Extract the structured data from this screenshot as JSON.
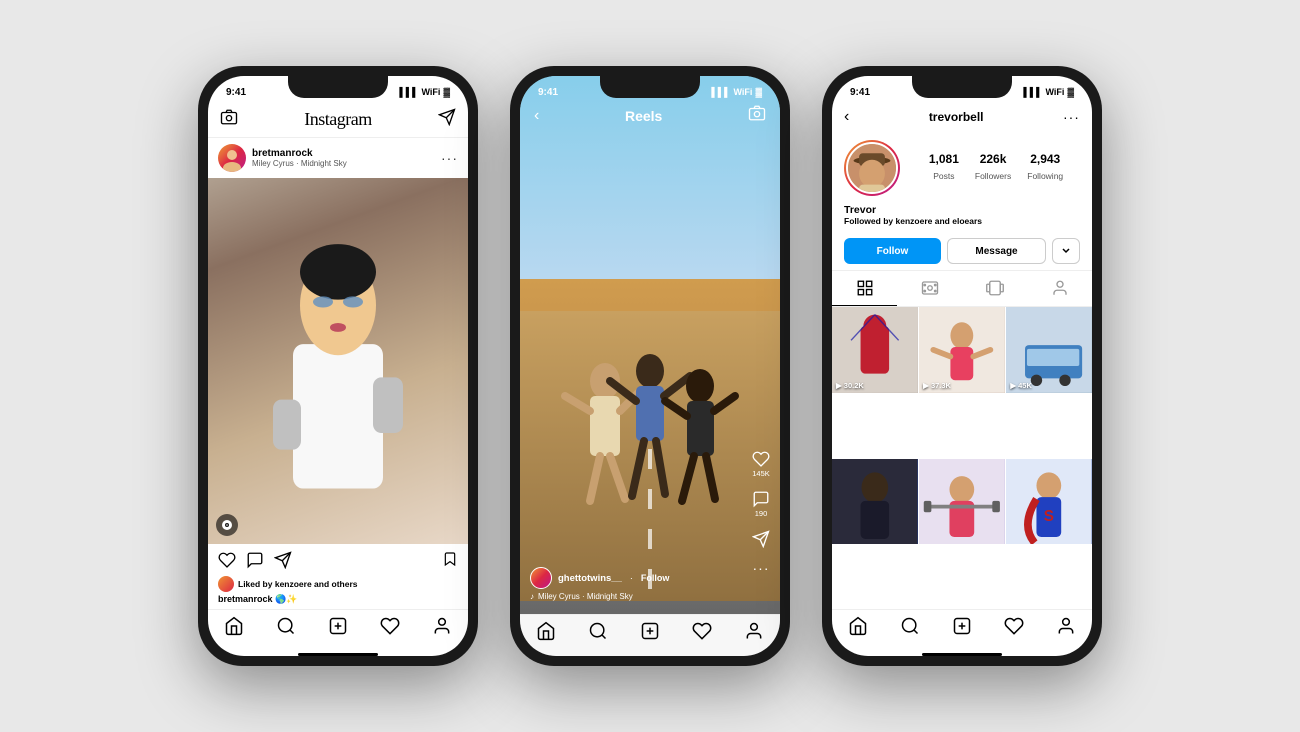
{
  "page": {
    "bg_color": "#e8e8e8"
  },
  "phone1": {
    "status_time": "9:41",
    "header_title": "Instagram",
    "post": {
      "username": "bretmanrock",
      "music": "Miley Cyrus · Midnight Sky",
      "liked_by": "Liked by kenzoere and others",
      "caption_user": "bretmanrock",
      "caption_text": "🌎✨"
    },
    "nav": {
      "home": "⌂",
      "search": "🔍",
      "add": "＋",
      "heart": "♡",
      "profile": "👤"
    }
  },
  "phone2": {
    "status_time": "9:41",
    "title": "Reels",
    "user": {
      "username": "ghettotwins__",
      "follow": "Follow",
      "music": "Miley Cyrus · Midnight Sky"
    },
    "actions": {
      "likes": "145K",
      "comments": "190"
    }
  },
  "phone3": {
    "status_time": "9:41",
    "username": "trevorbell",
    "profile": {
      "name": "Trevor",
      "posts": "1,081",
      "posts_label": "Posts",
      "followers": "226k",
      "followers_label": "Followers",
      "following": "2,943",
      "following_label": "Following",
      "followed_by_text": "Followed by",
      "follower1": "kenzoere",
      "connector": "and",
      "follower2": "eloears"
    },
    "buttons": {
      "follow": "Follow",
      "message": "Message",
      "dropdown": "▾"
    },
    "grid": [
      {
        "views": "30.2K",
        "color": "gi1"
      },
      {
        "views": "37.3K",
        "color": "gi2"
      },
      {
        "views": "45K",
        "color": "gi3"
      },
      {
        "views": "",
        "color": "gi4"
      },
      {
        "views": "",
        "color": "gi5"
      },
      {
        "views": "",
        "color": "gi6"
      }
    ]
  }
}
